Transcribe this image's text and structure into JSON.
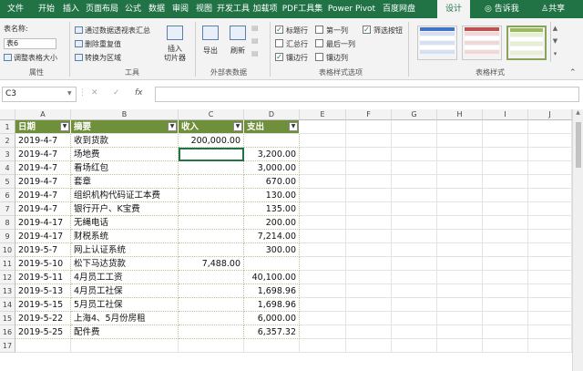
{
  "tabs": [
    "文件",
    "开始",
    "插入",
    "页面布局",
    "公式",
    "数据",
    "审阅",
    "视图",
    "开发工具",
    "加载项",
    "PDF工具集",
    "Power Pivot",
    "百度网盘",
    "设计"
  ],
  "tell_me": "告诉我",
  "share": "共享",
  "ribbon": {
    "table_name_label": "表名称:",
    "table_name_value": "表6",
    "resize_table": "调整表格大小",
    "properties_label": "属性",
    "summarize_pivot": "通过数据透视表汇总",
    "remove_duplicates": "删除重复值",
    "convert_range": "转换为区域",
    "insert_slicer_1": "插入",
    "insert_slicer_2": "切片器",
    "tools_label": "工具",
    "export": "导出",
    "refresh": "刷新",
    "external_label": "外部表数据",
    "options": {
      "header_row": "标题行",
      "first_column": "第一列",
      "filter_button": "筛选按钮",
      "total_row": "汇总行",
      "last_column": "最后一列",
      "banded_rows": "镶边行",
      "banded_columns": "镶边列"
    },
    "options_label": "表格样式选项",
    "styles_label": "表格样式",
    "style_colors": [
      "#4472c4",
      "#c0504d",
      "#9bbb59"
    ]
  },
  "formula_bar": {
    "name_box": "C3",
    "cancel_icon": "✕",
    "enter_icon": "✓",
    "fx": "fx",
    "formula": ""
  },
  "columns": [
    "A",
    "B",
    "C",
    "D",
    "E",
    "F",
    "G",
    "H",
    "I",
    "J"
  ],
  "table": {
    "headers": [
      "日期",
      "摘要",
      "收入",
      "支出"
    ],
    "rows": [
      [
        "2019-4-7",
        "收到货款",
        "200,000.00",
        ""
      ],
      [
        "2019-4-7",
        "场地费",
        "",
        "3,200.00"
      ],
      [
        "2019-4-7",
        "看场红包",
        "",
        "3,000.00"
      ],
      [
        "2019-4-7",
        "套章",
        "",
        "670.00"
      ],
      [
        "2019-4-7",
        "组织机构代码证工本费",
        "",
        "130.00"
      ],
      [
        "2019-4-7",
        "银行开户、K宝费",
        "",
        "135.00"
      ],
      [
        "2019-4-17",
        "无绳电话",
        "",
        "200.00"
      ],
      [
        "2019-4-17",
        "财税系统",
        "",
        "7,214.00"
      ],
      [
        "2019-5-7",
        "网上认证系统",
        "",
        "300.00"
      ],
      [
        "2019-5-10",
        "松下马达货款",
        "7,488.00",
        ""
      ],
      [
        "2019-5-11",
        "4月员工工资",
        "",
        "40,100.00"
      ],
      [
        "2019-5-13",
        "4月员工社保",
        "",
        "1,698.96"
      ],
      [
        "2019-5-15",
        "5月员工社保",
        "",
        "1,698.96"
      ],
      [
        "2019-5-22",
        "上海4、5月份房租",
        "",
        "6,000.00"
      ],
      [
        "2019-5-25",
        "配件费",
        "",
        "6,357.32"
      ]
    ]
  },
  "row_numbers": [
    "1",
    "2",
    "3",
    "4",
    "5",
    "6",
    "7",
    "8",
    "9",
    "10",
    "11",
    "12",
    "13",
    "14",
    "15",
    "16",
    "17"
  ]
}
